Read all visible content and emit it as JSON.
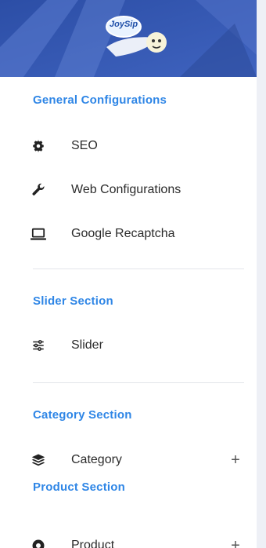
{
  "brand": {
    "logo_text": "JoySip",
    "icon": "brand-logo"
  },
  "sections": [
    {
      "title": "General Configurations"
    },
    {
      "title": "Slider Section"
    },
    {
      "title": "Category Section"
    },
    {
      "title": "Product Section"
    }
  ],
  "items": {
    "seo": {
      "label": "SEO",
      "icon": "gear-icon"
    },
    "web_config": {
      "label": "Web Configurations",
      "icon": "wrench-icon"
    },
    "recaptcha": {
      "label": "Google Recaptcha",
      "icon": "laptop-icon"
    },
    "slider": {
      "label": "Slider",
      "icon": "sliders-icon"
    },
    "category": {
      "label": "Category",
      "icon": "layers-icon",
      "expand": "+"
    },
    "product": {
      "label": "Product",
      "icon": "product-icon",
      "expand": "+"
    }
  },
  "colors": {
    "section_title": "#2f86e6",
    "brand_bg": "#3a5ab1",
    "text": "#2b2b2b"
  }
}
